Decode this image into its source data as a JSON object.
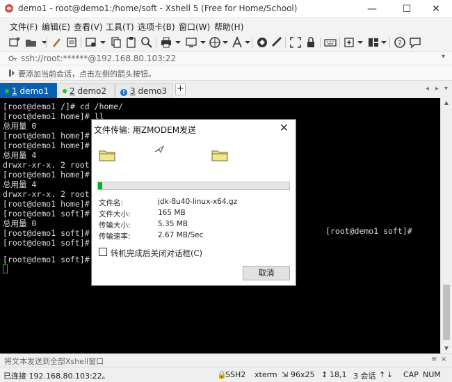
{
  "window": {
    "title": "demo1 - root@demo1:/home/soft - Xshell 5 (Free for Home/School)",
    "minimize": "—",
    "maximize": "☐",
    "close": "✕"
  },
  "menu": {
    "items": [
      "文件(F)",
      "编辑(E)",
      "查看(V)",
      "工具(T)",
      "选项卡(B)",
      "窗口(W)",
      "帮助(H)"
    ]
  },
  "address": {
    "text": "ssh://root:******@192.168.80.103:22"
  },
  "hint": {
    "text": "要添加当前会话，点击左侧的箭头按钮。"
  },
  "tabs": [
    {
      "number": "1",
      "label": "demo1",
      "status_color": "#1dc61d",
      "active": true
    },
    {
      "number": "2",
      "label": "demo2",
      "status_color": "#1dc61d",
      "active": false
    },
    {
      "number": "3",
      "label": "demo3",
      "status_color": "#1a73c8",
      "active": false
    }
  ],
  "tab_add": "+",
  "tab_nav": [
    "◂",
    "▸",
    "▾"
  ],
  "terminal": {
    "lines": [
      "[root@demo1 /]# cd /home/",
      "[root@demo1 home]# ll",
      "总用量 0",
      "[root@demo1 home]# m",
      "[root@demo1 home]# l",
      "总用量 4",
      "drwxr-xr-x. 2 root r",
      "[root@demo1 home]# l",
      "总用量 4",
      "drwxr-xr-x. 2 root r",
      "[root@demo1 home]# c",
      "[root@demo1 soft]# l",
      "总用量 0",
      "[root@demo1 soft]# r",
      "[root@demo1 soft]# r",
      "",
      "[root@demo1 soft]# r"
    ],
    "side_prompt": "[root@demo1 soft]#"
  },
  "dialog": {
    "title": "文件传输: 用ZMODEM发送",
    "close": "✕",
    "progress": 0.02,
    "labels": [
      "文件名:",
      "文件大小:",
      "传输大小:",
      "传输速率:"
    ],
    "values": [
      "jdk-8u40-linux-x64.gz",
      "165 MB",
      "5.35 MB",
      "2.67 MB/Sec"
    ],
    "checkbox_label": "转机完成后关闭对话框(C)",
    "cancel_label": "取消"
  },
  "sendbar": {
    "text": "将文本发送到全部Xshell窗口"
  },
  "status": {
    "connection": "已连接 192.168.80.103:22。",
    "protocol": "SSH2",
    "terminal": "xterm",
    "size": "96x25",
    "cursor": "18,1",
    "sessions": "3 会话",
    "cap": "CAP",
    "num": "NUM"
  }
}
